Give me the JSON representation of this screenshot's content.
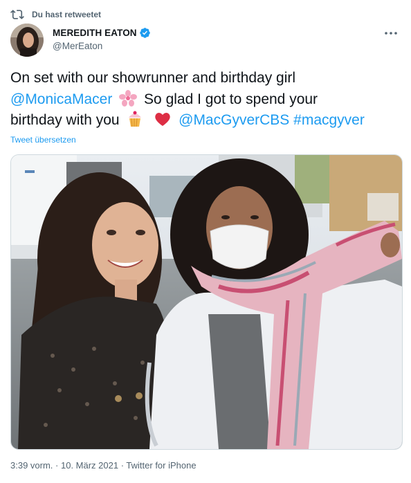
{
  "retweet": {
    "label": "Du hast retweetet"
  },
  "author": {
    "display_name": "MEREDITH EATON",
    "handle": "@MerEaton",
    "verified": true
  },
  "tweet": {
    "line1": "On set with our showrunner and birthday girl",
    "mention1": "@MonicaMacer",
    "text2": "So glad I got to spend your",
    "text3": "birthday with you",
    "mention2": "@MacGyverCBS",
    "hashtag": "#macgyver",
    "emoji": [
      "cherry-blossom",
      "cupcake",
      "red-heart"
    ]
  },
  "translate": {
    "label": "Tweet übersetzen"
  },
  "meta": {
    "time": "3:39 vorm.",
    "date": "10. März 2021",
    "source": "Twitter for iPhone",
    "separator": " · "
  },
  "colors": {
    "link": "#1d9bf0",
    "muted": "#536471",
    "verified": "#1d9bf0",
    "text": "#0f1419"
  }
}
